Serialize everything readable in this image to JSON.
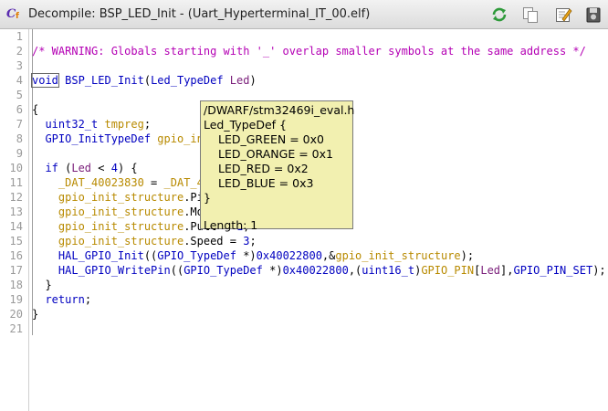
{
  "window": {
    "title": "Decompile: BSP_LED_Init -  (Uart_Hyperterminal_IT_00.elf)",
    "app_icon_letter": "C",
    "app_icon_sub": "f"
  },
  "toolbar": {
    "buttons": [
      "refresh-icon",
      "copy-icon",
      "edit-icon",
      "snapshot-icon"
    ],
    "accent": "#2e9a3a"
  },
  "code": {
    "line_numbers": [
      "1",
      "2",
      "3",
      "4",
      "5",
      "6",
      "7",
      "8",
      "9",
      "10",
      "11",
      "12",
      "13",
      "14",
      "15",
      "16",
      "17",
      "18",
      "19",
      "20",
      "21"
    ],
    "lines": [
      "",
      "/* WARNING: Globals starting with '_' overlap smaller symbols at the same address */",
      "",
      "void BSP_LED_Init(Led_TypeDef Led)",
      "",
      "{",
      "  uint32_t tmpreg;",
      "  GPIO_InitTypeDef gpio_init_structure;",
      "",
      "  if (Led < 4) {",
      "    _DAT_40023830 = _DAT_40023830 | 0x40;",
      "    gpio_init_structure.Pin = GPIO_PIN[Led];",
      "    gpio_init_structure.Mode = 1;",
      "    gpio_init_structure.Pull = 1;",
      "    gpio_init_structure.Speed = 3;",
      "    HAL_GPIO_Init((GPIO_TypeDef *)0x40022800,&gpio_init_structure);",
      "    HAL_GPIO_WritePin((GPIO_TypeDef *)0x40022800,(uint16_t)GPIO_PIN[Led],GPIO_PIN_SET);",
      "  }",
      "  return;",
      "}",
      ""
    ]
  },
  "tooltip": {
    "header": "/DWARF/stm32469i_eval.h",
    "type_open": "Led_TypeDef {",
    "members": [
      "LED_GREEN = 0x0",
      "LED_ORANGE = 0x1",
      "LED_RED = 0x2",
      "LED_BLUE = 0x3"
    ],
    "close": "}",
    "length": "Length: 1"
  }
}
